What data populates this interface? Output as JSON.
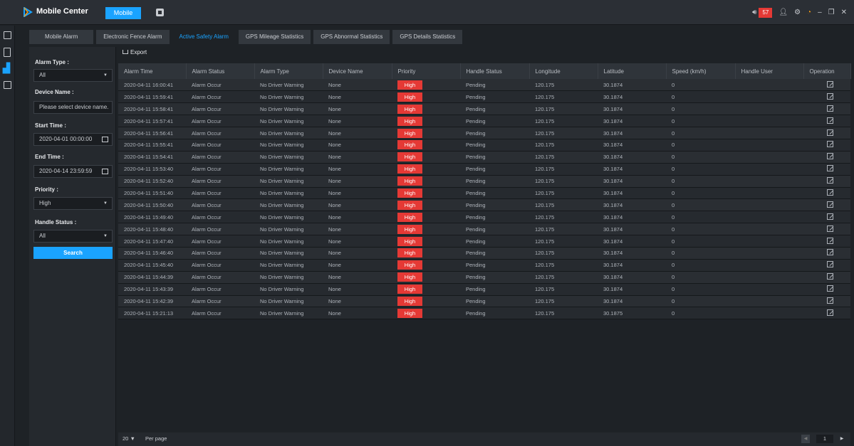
{
  "titlebar": {
    "app_title": "Mobile Center",
    "module_tab": "Mobile",
    "alarm_count": "57"
  },
  "subtabs": [
    "Mobile Alarm",
    "Electronic Fence Alarm",
    "Active Safety Alarm",
    "GPS Mileage Statistics",
    "GPS Abnormal Statistics",
    "GPS Details Statistics"
  ],
  "filter": {
    "alarm_type_label": "Alarm Type :",
    "alarm_type_value": "All",
    "device_name_label": "Device Name :",
    "device_name_placeholder": "Please select device name.",
    "start_time_label": "Start Time :",
    "start_time_value": "2020-04-01 00:00:00",
    "end_time_label": "End Time :",
    "end_time_value": "2020-04-14 23:59:59",
    "priority_label": "Priority :",
    "priority_value": "High",
    "handle_status_label": "Handle Status :",
    "handle_status_value": "All",
    "search_label": "Search"
  },
  "main": {
    "export_label": "Export",
    "columns": [
      "Alarm Time",
      "Alarm Status",
      "Alarm Type",
      "Device Name",
      "Priority",
      "Handle Status",
      "Longitude",
      "Latitude",
      "Speed (km/h)",
      "Handle User",
      "Operation"
    ],
    "rows": [
      [
        "2020-04-11 16:00:41",
        "Alarm Occur",
        "No Driver Warning",
        "None",
        "High",
        "Pending",
        "120.175",
        "30.1874",
        "0",
        ""
      ],
      [
        "2020-04-11 15:59:41",
        "Alarm Occur",
        "No Driver Warning",
        "None",
        "High",
        "Pending",
        "120.175",
        "30.1874",
        "0",
        ""
      ],
      [
        "2020-04-11 15:58:41",
        "Alarm Occur",
        "No Driver Warning",
        "None",
        "High",
        "Pending",
        "120.175",
        "30.1874",
        "0",
        ""
      ],
      [
        "2020-04-11 15:57:41",
        "Alarm Occur",
        "No Driver Warning",
        "None",
        "High",
        "Pending",
        "120.175",
        "30.1874",
        "0",
        ""
      ],
      [
        "2020-04-11 15:56:41",
        "Alarm Occur",
        "No Driver Warning",
        "None",
        "High",
        "Pending",
        "120.175",
        "30.1874",
        "0",
        ""
      ],
      [
        "2020-04-11 15:55:41",
        "Alarm Occur",
        "No Driver Warning",
        "None",
        "High",
        "Pending",
        "120.175",
        "30.1874",
        "0",
        ""
      ],
      [
        "2020-04-11 15:54:41",
        "Alarm Occur",
        "No Driver Warning",
        "None",
        "High",
        "Pending",
        "120.175",
        "30.1874",
        "0",
        ""
      ],
      [
        "2020-04-11 15:53:40",
        "Alarm Occur",
        "No Driver Warning",
        "None",
        "High",
        "Pending",
        "120.175",
        "30.1874",
        "0",
        ""
      ],
      [
        "2020-04-11 15:52:40",
        "Alarm Occur",
        "No Driver Warning",
        "None",
        "High",
        "Pending",
        "120.175",
        "30.1874",
        "0",
        ""
      ],
      [
        "2020-04-11 15:51:40",
        "Alarm Occur",
        "No Driver Warning",
        "None",
        "High",
        "Pending",
        "120.175",
        "30.1874",
        "0",
        ""
      ],
      [
        "2020-04-11 15:50:40",
        "Alarm Occur",
        "No Driver Warning",
        "None",
        "High",
        "Pending",
        "120.175",
        "30.1874",
        "0",
        ""
      ],
      [
        "2020-04-11 15:49:40",
        "Alarm Occur",
        "No Driver Warning",
        "None",
        "High",
        "Pending",
        "120.175",
        "30.1874",
        "0",
        ""
      ],
      [
        "2020-04-11 15:48:40",
        "Alarm Occur",
        "No Driver Warning",
        "None",
        "High",
        "Pending",
        "120.175",
        "30.1874",
        "0",
        ""
      ],
      [
        "2020-04-11 15:47:40",
        "Alarm Occur",
        "No Driver Warning",
        "None",
        "High",
        "Pending",
        "120.175",
        "30.1874",
        "0",
        ""
      ],
      [
        "2020-04-11 15:46:40",
        "Alarm Occur",
        "No Driver Warning",
        "None",
        "High",
        "Pending",
        "120.175",
        "30.1874",
        "0",
        ""
      ],
      [
        "2020-04-11 15:45:40",
        "Alarm Occur",
        "No Driver Warning",
        "None",
        "High",
        "Pending",
        "120.175",
        "30.1874",
        "0",
        ""
      ],
      [
        "2020-04-11 15:44:39",
        "Alarm Occur",
        "No Driver Warning",
        "None",
        "High",
        "Pending",
        "120.175",
        "30.1874",
        "0",
        ""
      ],
      [
        "2020-04-11 15:43:39",
        "Alarm Occur",
        "No Driver Warning",
        "None",
        "High",
        "Pending",
        "120.175",
        "30.1874",
        "0",
        ""
      ],
      [
        "2020-04-11 15:42:39",
        "Alarm Occur",
        "No Driver Warning",
        "None",
        "High",
        "Pending",
        "120.175",
        "30.1874",
        "0",
        ""
      ],
      [
        "2020-04-11 15:21:13",
        "Alarm Occur",
        "No Driver Warning",
        "None",
        "High",
        "Pending",
        "120.175",
        "30.1875",
        "0",
        ""
      ]
    ]
  },
  "footer": {
    "per_page_value": "20",
    "per_page_label": "Per page",
    "current_page": "1"
  },
  "colors": {
    "accent": "#1aa3ff",
    "priority_high": "#e53935"
  }
}
